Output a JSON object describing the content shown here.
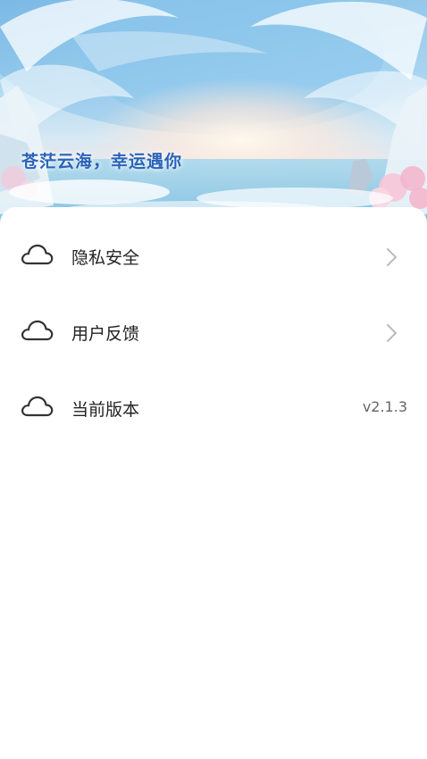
{
  "hero": {
    "title": "苍茫云海，幸运遇你"
  },
  "settings": {
    "items": [
      {
        "label": "隐私安全",
        "icon": "cloud-icon",
        "action": "chevron-right-icon"
      },
      {
        "label": "用户反馈",
        "icon": "cloud-icon",
        "action": "chevron-right-icon"
      },
      {
        "label": "当前版本",
        "icon": "cloud-icon",
        "value": "v2.1.3"
      }
    ]
  },
  "colors": {
    "title": "#2a63b8",
    "label": "#222222",
    "value": "#666666",
    "icon_stroke": "#333333",
    "chevron": "#bbbbbb"
  }
}
